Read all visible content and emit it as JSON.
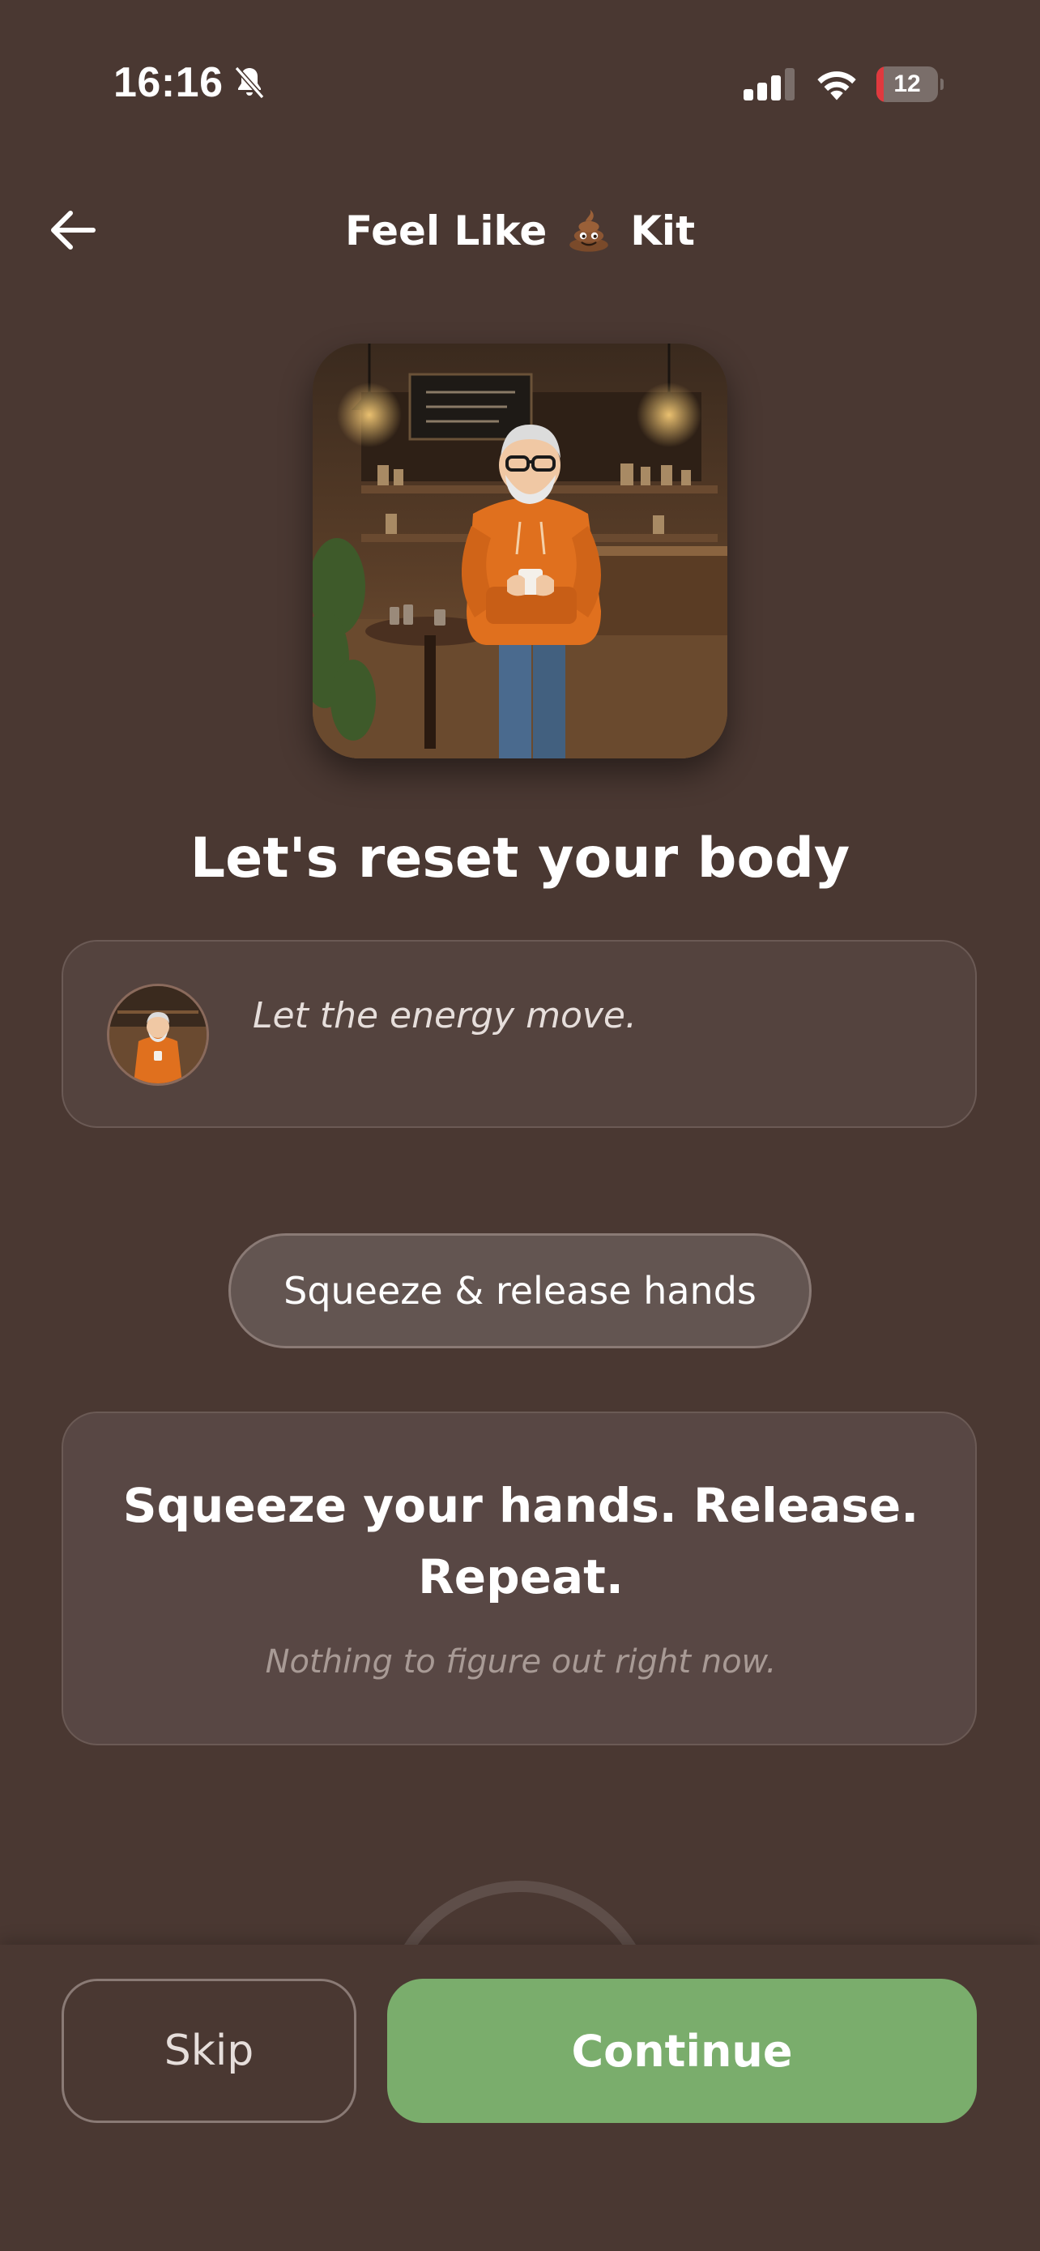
{
  "status_bar": {
    "time": "16:16",
    "battery_level": "12",
    "battery_fraction": 0.12,
    "icons": [
      "bell-slash-icon",
      "cellular-signal-icon",
      "wifi-icon",
      "battery-icon"
    ]
  },
  "header": {
    "back_icon": "arrow-left-icon",
    "title_before": "Feel Like",
    "title_emoji": "poop-emoji-icon",
    "title_after": "Kit"
  },
  "hero": {
    "image": "illustrated-man-orange-hoodie-coffee-shop"
  },
  "main": {
    "heading": "Let's reset your body",
    "quote": {
      "avatar": "illustrated-man-orange-hoodie-avatar",
      "text": "Let the energy move."
    },
    "exercise_pill": "Squeeze & release hands",
    "instruction": {
      "title": "Squeeze your hands. Release. Repeat.",
      "subtitle": "Nothing to figure out right now."
    }
  },
  "footer": {
    "skip_label": "Skip",
    "continue_label": "Continue"
  },
  "colors": {
    "background": "#4a3832",
    "card": "#54433e",
    "pill": "#635551",
    "accent_green": "#7aad6c",
    "battery_red": "#e0393e"
  }
}
